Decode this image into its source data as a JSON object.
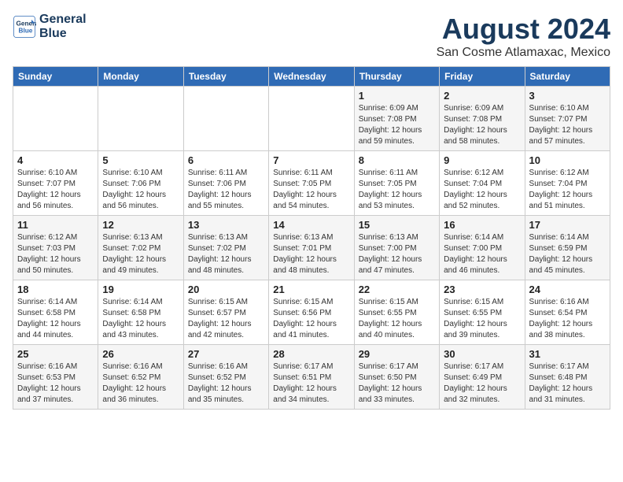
{
  "header": {
    "logo_line1": "General",
    "logo_line2": "Blue",
    "main_title": "August 2024",
    "subtitle": "San Cosme Atlamaxac, Mexico"
  },
  "days_of_week": [
    "Sunday",
    "Monday",
    "Tuesday",
    "Wednesday",
    "Thursday",
    "Friday",
    "Saturday"
  ],
  "weeks": [
    [
      {
        "num": "",
        "info": ""
      },
      {
        "num": "",
        "info": ""
      },
      {
        "num": "",
        "info": ""
      },
      {
        "num": "",
        "info": ""
      },
      {
        "num": "1",
        "info": "Sunrise: 6:09 AM\nSunset: 7:08 PM\nDaylight: 12 hours\nand 59 minutes."
      },
      {
        "num": "2",
        "info": "Sunrise: 6:09 AM\nSunset: 7:08 PM\nDaylight: 12 hours\nand 58 minutes."
      },
      {
        "num": "3",
        "info": "Sunrise: 6:10 AM\nSunset: 7:07 PM\nDaylight: 12 hours\nand 57 minutes."
      }
    ],
    [
      {
        "num": "4",
        "info": "Sunrise: 6:10 AM\nSunset: 7:07 PM\nDaylight: 12 hours\nand 56 minutes."
      },
      {
        "num": "5",
        "info": "Sunrise: 6:10 AM\nSunset: 7:06 PM\nDaylight: 12 hours\nand 56 minutes."
      },
      {
        "num": "6",
        "info": "Sunrise: 6:11 AM\nSunset: 7:06 PM\nDaylight: 12 hours\nand 55 minutes."
      },
      {
        "num": "7",
        "info": "Sunrise: 6:11 AM\nSunset: 7:05 PM\nDaylight: 12 hours\nand 54 minutes."
      },
      {
        "num": "8",
        "info": "Sunrise: 6:11 AM\nSunset: 7:05 PM\nDaylight: 12 hours\nand 53 minutes."
      },
      {
        "num": "9",
        "info": "Sunrise: 6:12 AM\nSunset: 7:04 PM\nDaylight: 12 hours\nand 52 minutes."
      },
      {
        "num": "10",
        "info": "Sunrise: 6:12 AM\nSunset: 7:04 PM\nDaylight: 12 hours\nand 51 minutes."
      }
    ],
    [
      {
        "num": "11",
        "info": "Sunrise: 6:12 AM\nSunset: 7:03 PM\nDaylight: 12 hours\nand 50 minutes."
      },
      {
        "num": "12",
        "info": "Sunrise: 6:13 AM\nSunset: 7:02 PM\nDaylight: 12 hours\nand 49 minutes."
      },
      {
        "num": "13",
        "info": "Sunrise: 6:13 AM\nSunset: 7:02 PM\nDaylight: 12 hours\nand 48 minutes."
      },
      {
        "num": "14",
        "info": "Sunrise: 6:13 AM\nSunset: 7:01 PM\nDaylight: 12 hours\nand 48 minutes."
      },
      {
        "num": "15",
        "info": "Sunrise: 6:13 AM\nSunset: 7:00 PM\nDaylight: 12 hours\nand 47 minutes."
      },
      {
        "num": "16",
        "info": "Sunrise: 6:14 AM\nSunset: 7:00 PM\nDaylight: 12 hours\nand 46 minutes."
      },
      {
        "num": "17",
        "info": "Sunrise: 6:14 AM\nSunset: 6:59 PM\nDaylight: 12 hours\nand 45 minutes."
      }
    ],
    [
      {
        "num": "18",
        "info": "Sunrise: 6:14 AM\nSunset: 6:58 PM\nDaylight: 12 hours\nand 44 minutes."
      },
      {
        "num": "19",
        "info": "Sunrise: 6:14 AM\nSunset: 6:58 PM\nDaylight: 12 hours\nand 43 minutes."
      },
      {
        "num": "20",
        "info": "Sunrise: 6:15 AM\nSunset: 6:57 PM\nDaylight: 12 hours\nand 42 minutes."
      },
      {
        "num": "21",
        "info": "Sunrise: 6:15 AM\nSunset: 6:56 PM\nDaylight: 12 hours\nand 41 minutes."
      },
      {
        "num": "22",
        "info": "Sunrise: 6:15 AM\nSunset: 6:55 PM\nDaylight: 12 hours\nand 40 minutes."
      },
      {
        "num": "23",
        "info": "Sunrise: 6:15 AM\nSunset: 6:55 PM\nDaylight: 12 hours\nand 39 minutes."
      },
      {
        "num": "24",
        "info": "Sunrise: 6:16 AM\nSunset: 6:54 PM\nDaylight: 12 hours\nand 38 minutes."
      }
    ],
    [
      {
        "num": "25",
        "info": "Sunrise: 6:16 AM\nSunset: 6:53 PM\nDaylight: 12 hours\nand 37 minutes."
      },
      {
        "num": "26",
        "info": "Sunrise: 6:16 AM\nSunset: 6:52 PM\nDaylight: 12 hours\nand 36 minutes."
      },
      {
        "num": "27",
        "info": "Sunrise: 6:16 AM\nSunset: 6:52 PM\nDaylight: 12 hours\nand 35 minutes."
      },
      {
        "num": "28",
        "info": "Sunrise: 6:17 AM\nSunset: 6:51 PM\nDaylight: 12 hours\nand 34 minutes."
      },
      {
        "num": "29",
        "info": "Sunrise: 6:17 AM\nSunset: 6:50 PM\nDaylight: 12 hours\nand 33 minutes."
      },
      {
        "num": "30",
        "info": "Sunrise: 6:17 AM\nSunset: 6:49 PM\nDaylight: 12 hours\nand 32 minutes."
      },
      {
        "num": "31",
        "info": "Sunrise: 6:17 AM\nSunset: 6:48 PM\nDaylight: 12 hours\nand 31 minutes."
      }
    ]
  ]
}
